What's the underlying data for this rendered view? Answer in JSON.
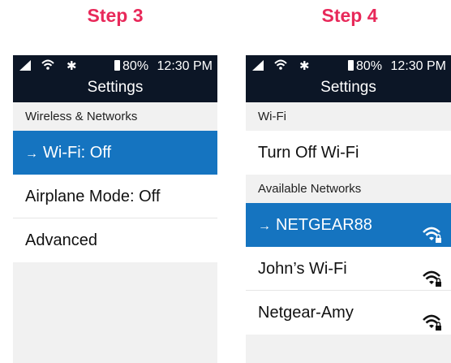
{
  "step3": {
    "title": "Step 3",
    "status": {
      "battery": "80%",
      "time": "12:30 PM"
    },
    "header_title": "Settings",
    "section": "Wireless & Networks",
    "items": [
      {
        "label": "Wi-Fi: Off",
        "selected": true
      },
      {
        "label": "Airplane Mode: Off"
      },
      {
        "label": "Advanced"
      }
    ]
  },
  "step4": {
    "title": "Step 4",
    "status": {
      "battery": "80%",
      "time": "12:30 PM"
    },
    "header_title": "Settings",
    "section_wifi": "Wi-Fi",
    "turn_off": "Turn Off Wi-Fi",
    "section_networks": "Available Networks",
    "networks": [
      {
        "name": "NETGEAR88",
        "selected": true,
        "icon": "wifi-locked-icon"
      },
      {
        "name": "John’s Wi-Fi",
        "icon": "wifi-locked-icon"
      },
      {
        "name": "Netgear-Amy",
        "icon": "wifi-locked-icon"
      }
    ]
  },
  "colors": {
    "step_title": "#e8295a",
    "header": "#0c1626",
    "selected": "#1574c0"
  },
  "arrow": "→"
}
